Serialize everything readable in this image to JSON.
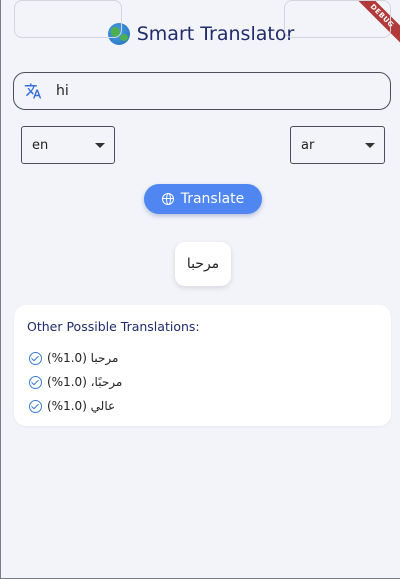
{
  "debug_banner": "DEBUG",
  "header": {
    "globe_icon": "globe-emoji",
    "title": "Smart Translator"
  },
  "input": {
    "icon": "translate-icon",
    "value": "hi"
  },
  "source_language": {
    "selected": "en"
  },
  "target_language": {
    "selected": "ar"
  },
  "translate_button": {
    "icon": "language-icon",
    "label": "Translate"
  },
  "result": {
    "text": "مرحبا"
  },
  "alternatives": {
    "heading": "Other Possible Translations:",
    "items": [
      {
        "text": "مرحبا (1.0%)",
        "icon": "check-circle-icon"
      },
      {
        "text": "مرحبًا، (1.0%)",
        "icon": "check-circle-icon"
      },
      {
        "text": "عالي (1.0%)",
        "icon": "check-circle-icon"
      }
    ]
  },
  "colors": {
    "background": "#f3f4fa",
    "title": "#1f2b6b",
    "button": "#4f86f2",
    "accent": "#3a7bd5",
    "debug_ribbon": "#b23a3a"
  }
}
